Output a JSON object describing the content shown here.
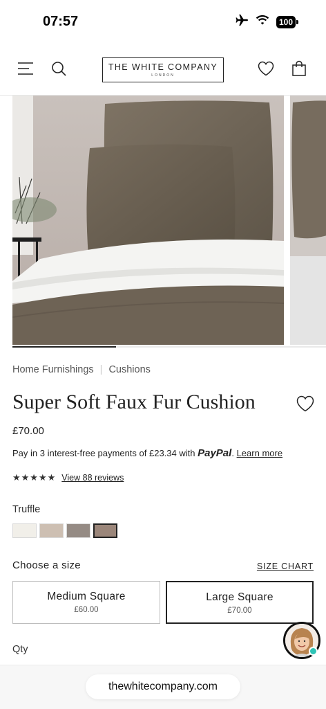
{
  "status_bar": {
    "time": "07:57",
    "battery": "100"
  },
  "header": {
    "brand_name": "THE WHITE COMPANY",
    "brand_sub": "LONDON"
  },
  "gallery": {
    "progress": 0.33
  },
  "breadcrumb": {
    "items": [
      "Home Furnishings",
      "Cushions"
    ]
  },
  "product": {
    "title": "Super Soft Faux Fur Cushion",
    "price": "£70.00",
    "paypal": {
      "text": "Pay in 3 interest-free payments of £23.34 with",
      "brand": "PayPal",
      "dot": ".",
      "link": "Learn more"
    },
    "rating": {
      "stars": "★★★★★",
      "value": 5,
      "reviews_link": "View 88 reviews"
    },
    "colour": {
      "label": "Truffle",
      "swatches": [
        "#f1efe9",
        "#cdbfb2",
        "#958b84",
        "#9b867a"
      ],
      "selected_index": 3
    },
    "size": {
      "label": "Choose a size",
      "chart_link": "SIZE CHART",
      "options": [
        {
          "name": "Medium Square",
          "price": "£60.00"
        },
        {
          "name": "Large Square",
          "price": "£70.00"
        }
      ],
      "selected_index": 1
    },
    "qty_label": "Qty"
  },
  "browser": {
    "url": "thewhitecompany.com"
  }
}
